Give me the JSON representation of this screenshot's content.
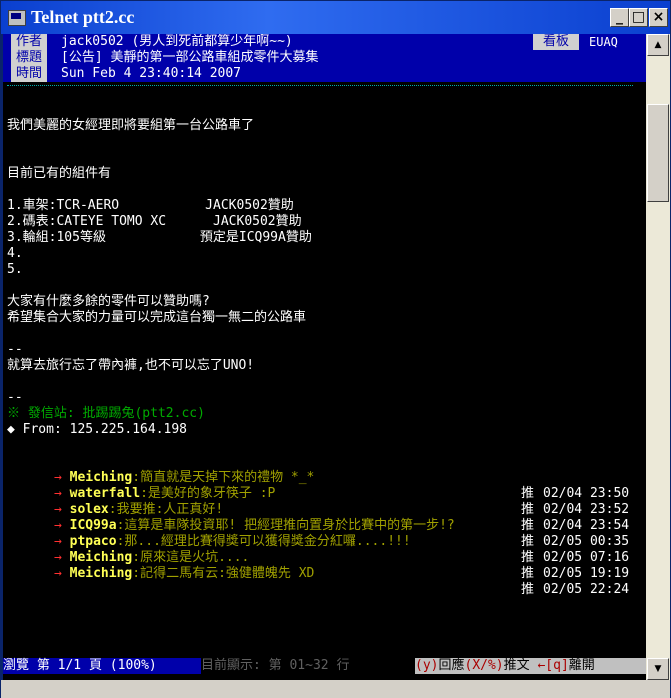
{
  "window": {
    "title": "Telnet ptt2.cc"
  },
  "header": {
    "author_label": "作者",
    "author_value": "jack0502 (男人到死前都算少年啊~~)",
    "title_label": "標題",
    "title_value": "[公告] 美靜的第一部公路車組成零件大募集",
    "time_label": "時間",
    "time_value": "Sun Feb  4 23:40:14 2007",
    "board_label": "看板",
    "board_value": "EUAQ"
  },
  "body": {
    "intro": "我們美麗的女經理即將要組第一台公路車了",
    "parts_heading": "目前已有的組件有",
    "parts": [
      "1.車架:TCR-AERO           JACK0502贊助",
      "2.碼表:CATEYE TOMO XC      JACK0502贊助",
      "3.輪組:105等級            預定是ICQ99A贊助",
      "4.",
      "5."
    ],
    "ask1": "大家有什麼多餘的零件可以贊助嗎?",
    "ask2": "希望集合大家的力量可以完成這台獨一無二的公路車",
    "sig_dash1": "--",
    "sig_text": "就算去旅行忘了帶內褲,也不可以忘了UNO!",
    "sig_dash2": "--",
    "origin": "※ 發信站: 批踢踢兔(ptt2.cc)",
    "from": "◆ From: 125.225.164.198"
  },
  "pushes": [
    {
      "arrow": "→",
      "user": "Meiching",
      "text": ":簡直就是天掉下來的禮物 *_*",
      "tag": "推",
      "date": "02/04 23:50"
    },
    {
      "arrow": "→",
      "user": "waterfall",
      "text": ":是美好的象牙筷子 :P",
      "tag": "推",
      "date": "02/04 23:52"
    },
    {
      "arrow": "→",
      "user": "solex",
      "text": ":我要推:人正真好!",
      "tag": "推",
      "date": "02/04 23:54"
    },
    {
      "arrow": "→",
      "user": "ICQ99a",
      "text": ":這算是車隊投資耶! 把經理推向置身於比賽中的第一步!?",
      "tag": "推",
      "date": "02/05 00:35"
    },
    {
      "arrow": "→",
      "user": "ptpaco",
      "text": ":那...經理比賽得獎可以獲得獎金分紅囉....!!!",
      "tag": "推",
      "date": "02/05 07:16"
    },
    {
      "arrow": "→",
      "user": "Meiching",
      "text": ":原來這是火坑....",
      "tag": "推",
      "date": "02/05 19:19"
    },
    {
      "arrow": "→",
      "user": "Meiching",
      "text": ":記得二馬有云:強健體魄先 XD",
      "tag": "推",
      "date": "02/05 22:24"
    }
  ],
  "footer": {
    "browse": " 瀏覽 第 1/1 頁 (100%) ",
    "display": " 目前顯示: 第 01~32 行",
    "k_reply": "(y)",
    "reply_label": "回應",
    "k_push": "(X/%)",
    "push_label": "推文 ",
    "k_leave": "←[q]",
    "leave_label": "離開"
  }
}
